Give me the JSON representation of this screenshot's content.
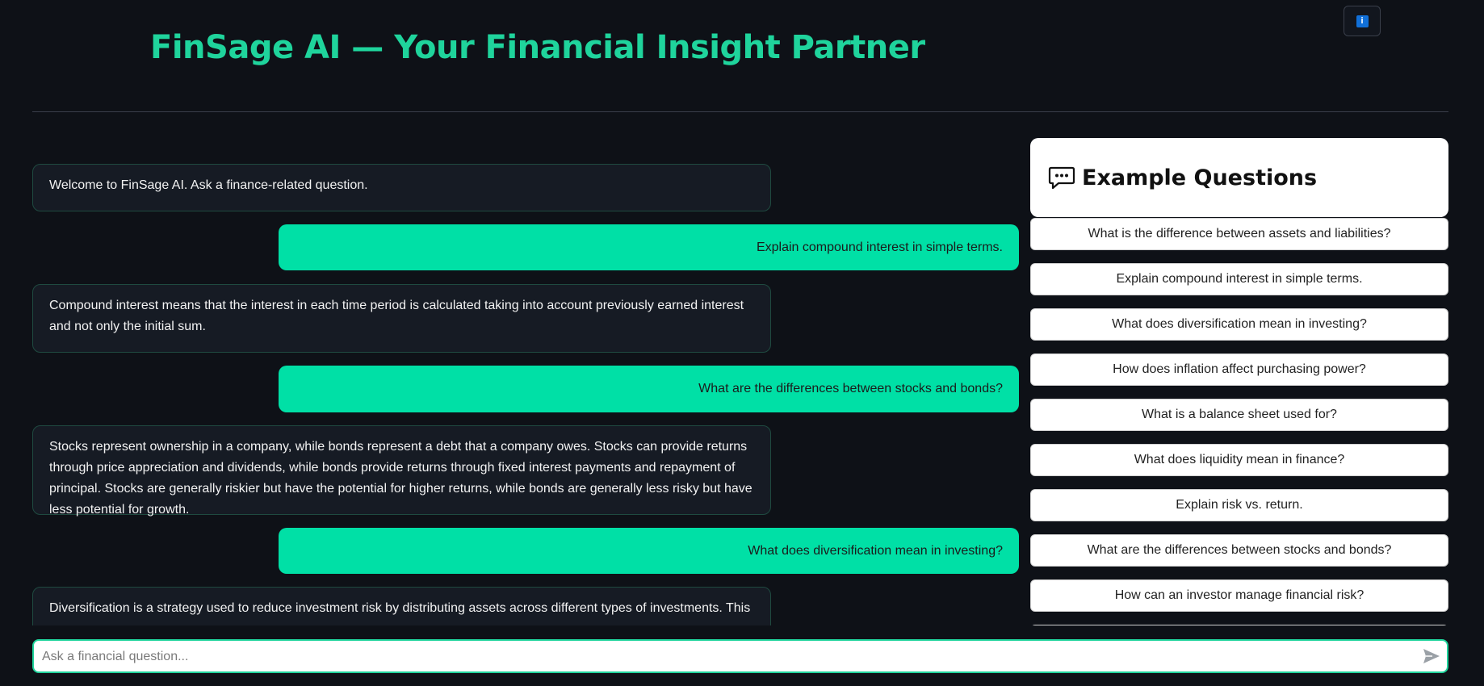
{
  "header": {
    "title": "FinSage AI — Your Financial Insight Partner",
    "info_icon": "i"
  },
  "chat": {
    "messages": [
      {
        "role": "assistant",
        "text": "Welcome to FinSage AI. Ask a finance-related question."
      },
      {
        "role": "user",
        "text": "Explain compound interest in simple terms."
      },
      {
        "role": "assistant",
        "text": "Compound interest means that the interest in each time period is calculated taking into account previously earned interest and not only the initial sum."
      },
      {
        "role": "user",
        "text": "What are the differences between stocks and bonds?"
      },
      {
        "role": "assistant",
        "text": "Stocks represent ownership in a company, while bonds represent a debt that a company owes. Stocks can provide returns through price appreciation and dividends, while bonds provide returns through fixed interest payments and repayment of principal. Stocks are generally riskier but have the potential for higher returns, while bonds are generally less risky but have less potential for growth."
      },
      {
        "role": "user",
        "text": "What does diversification mean in investing?"
      },
      {
        "role": "assistant",
        "text": "Diversification is a strategy used to reduce investment risk by distributing assets across different types of investments. This"
      }
    ]
  },
  "examples": {
    "title": "Example Questions",
    "icon": "chat-bubble-icon",
    "questions": [
      "What is the difference between assets and liabilities?",
      "Explain compound interest in simple terms.",
      "What does diversification mean in investing?",
      "How does inflation affect purchasing power?",
      "What is a balance sheet used for?",
      "What does liquidity mean in finance?",
      "Explain risk vs. return.",
      "What are the differences between stocks and bonds?",
      "How can an investor manage financial risk?"
    ]
  },
  "input": {
    "placeholder": "Ask a financial question...",
    "send_icon": "send-icon"
  },
  "colors": {
    "accent": "#1fd49c",
    "user_bubble": "#00e0a6",
    "background": "#0e1117",
    "assistant_bubble": "#161b24"
  }
}
